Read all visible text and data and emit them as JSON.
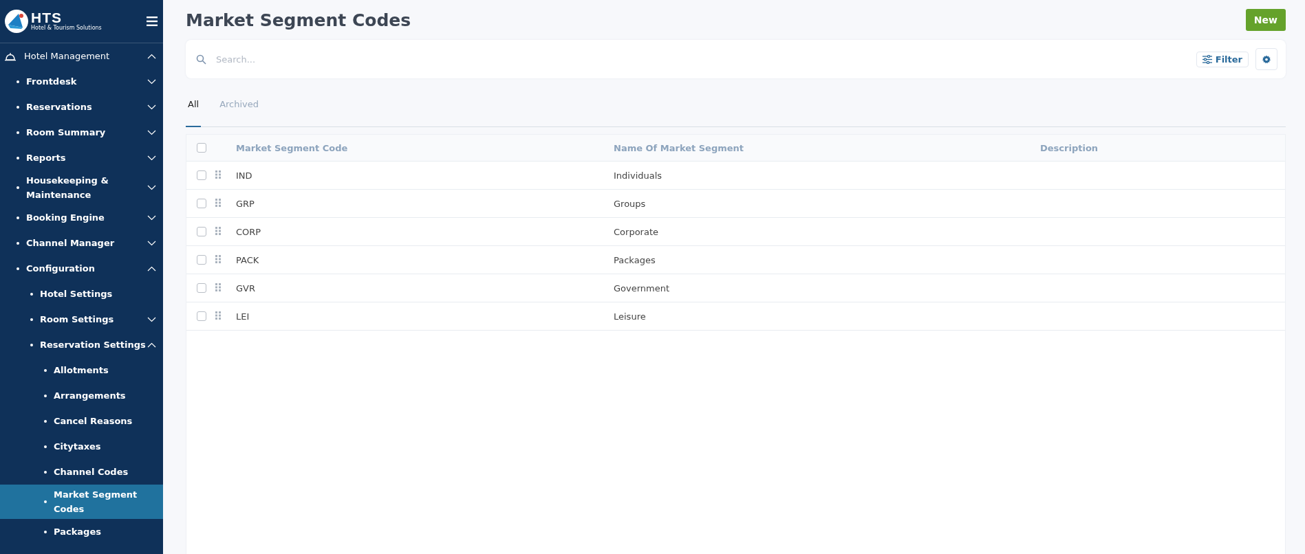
{
  "sidebar": {
    "logo": {
      "title": "HTS",
      "subtitle": "Hotel & Tourism Solutions"
    },
    "items": [
      {
        "label": "Hotel Management",
        "expanded": true,
        "selected": false,
        "children": [
          {
            "label": "Frontdesk",
            "expanded": false,
            "selected": false
          },
          {
            "label": "Reservations",
            "expanded": false,
            "selected": false
          },
          {
            "label": "Room Summary",
            "expanded": false,
            "selected": false
          },
          {
            "label": "Reports",
            "expanded": false,
            "selected": false
          },
          {
            "label": "Housekeeping & Maintenance",
            "expanded": false,
            "selected": false
          },
          {
            "label": "Booking Engine",
            "expanded": false,
            "selected": false
          },
          {
            "label": "Channel Manager",
            "expanded": false,
            "selected": false
          },
          {
            "label": "Configuration",
            "expanded": true,
            "selected": false,
            "children": [
              {
                "label": "Hotel Settings",
                "selected": false
              },
              {
                "label": "Room Settings",
                "expanded": false,
                "selected": false
              },
              {
                "label": "Reservation Settings",
                "expanded": true,
                "selected": false,
                "children": [
                  {
                    "label": "Allotments",
                    "selected": false
                  },
                  {
                    "label": "Arrangements",
                    "selected": false
                  },
                  {
                    "label": "Cancel Reasons",
                    "selected": false
                  },
                  {
                    "label": "Citytaxes",
                    "selected": false
                  },
                  {
                    "label": "Channel Codes",
                    "selected": false
                  },
                  {
                    "label": "Market Segment Codes",
                    "selected": true
                  },
                  {
                    "label": "Packages",
                    "selected": false
                  }
                ]
              }
            ]
          }
        ]
      }
    ]
  },
  "page": {
    "title": "Market Segment Codes",
    "new_button": "New"
  },
  "search": {
    "placeholder": "Search...",
    "filter_button": "Filter"
  },
  "tabs": [
    {
      "label": "All",
      "selected": true
    },
    {
      "label": "Archived",
      "selected": false
    }
  ],
  "table": {
    "columns": [
      "Market Segment Code",
      "Name Of Market Segment",
      "Description"
    ],
    "header_checked": false,
    "rows": [
      {
        "checked": false,
        "cells": [
          "IND",
          "Individuals"
        ]
      },
      {
        "checked": false,
        "cells": [
          "GRP",
          "Groups"
        ]
      },
      {
        "checked": false,
        "cells": [
          "CORP",
          "Corporate"
        ]
      },
      {
        "checked": false,
        "cells": [
          "PACK",
          "Packages"
        ]
      },
      {
        "checked": false,
        "cells": [
          "GVR",
          "Government"
        ]
      },
      {
        "checked": false,
        "cells": [
          "LEI",
          "Leisure"
        ]
      }
    ]
  }
}
